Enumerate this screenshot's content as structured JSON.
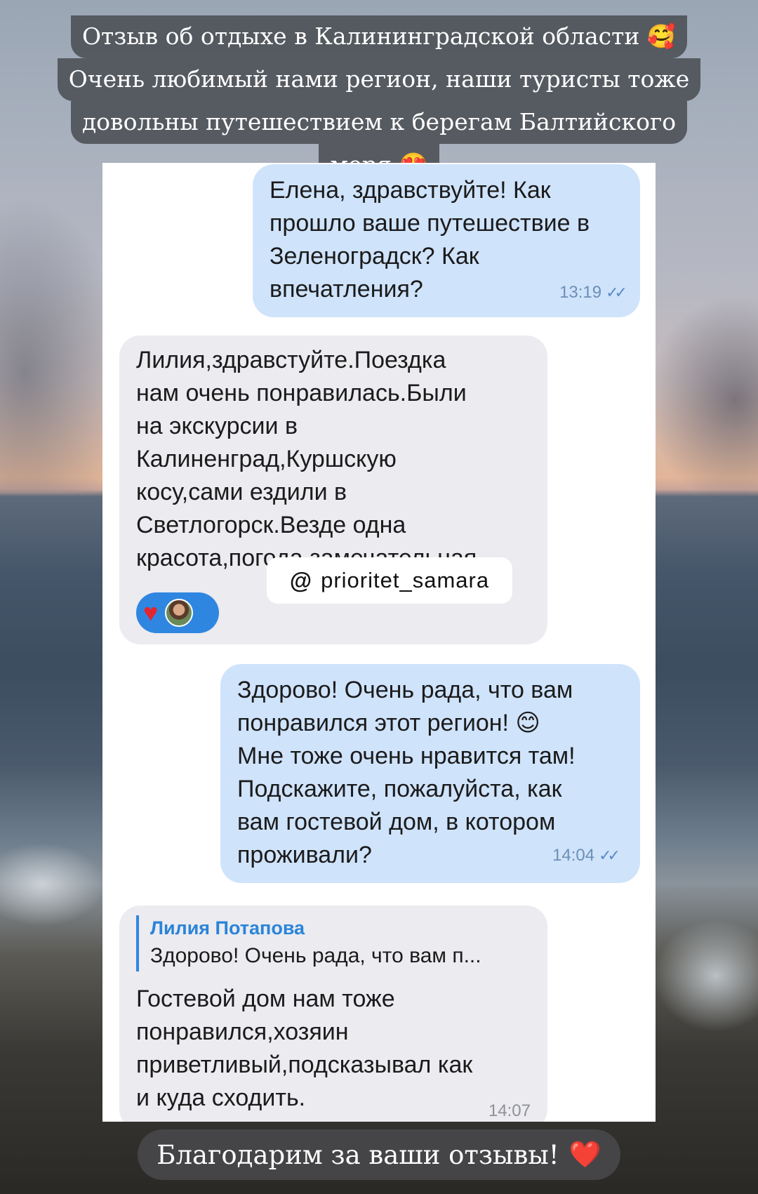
{
  "caption_top": {
    "lines": [
      "Отзыв об отдыхе в Калининградской области 🥰",
      "Очень любимый нами регион, наши туристы тоже",
      "довольны путешествием к берегам Балтийского",
      "моря 😍"
    ]
  },
  "messages": [
    {
      "direction": "outgoing",
      "text": "Елена, здравствуйте! Как\nпрошло ваше путешествие в\nЗеленоградск? Как\nвпечатления?",
      "time": "13:19",
      "status": "read"
    },
    {
      "direction": "incoming",
      "text": "Лилия,здравстуйте.Поездка\nнам очень понравилась.Были\nна экскурсии в\nКалиненград,Куршскую\nкосу,сами ездили в\nСветлогорск.Везде одна\nкрасота,погода замечательная.",
      "reaction": "heart"
    },
    {
      "direction": "outgoing",
      "text": "Здорово! Очень рада, что вам\nпонравился этот регион! 😊\nМне тоже очень нравится там!\nПодскажите, пожалуйста, как\nвам гостевой дом, в котором\nпроживали?",
      "time": "14:04",
      "status": "read"
    },
    {
      "direction": "incoming",
      "reply_to": {
        "name": "Лилия Потапова",
        "text": "Здорово! Очень рада, что вам п..."
      },
      "text": "Гостевой дом нам тоже\nпонравился,хозяин\nприветливый,подсказывал как\nи куда сходить.",
      "time": "14:07"
    }
  ],
  "watermark": {
    "symbol": "@",
    "handle": "prioritet_samara"
  },
  "caption_bottom": {
    "text": "Благодарим за ваши отзывы!",
    "emoji": "❤️"
  },
  "colors": {
    "outgoing_bubble": "#cfe3fb",
    "incoming_bubble": "#ebebf0",
    "reply_accent": "#2f86e0",
    "reaction_bg": "#2f86e0"
  }
}
